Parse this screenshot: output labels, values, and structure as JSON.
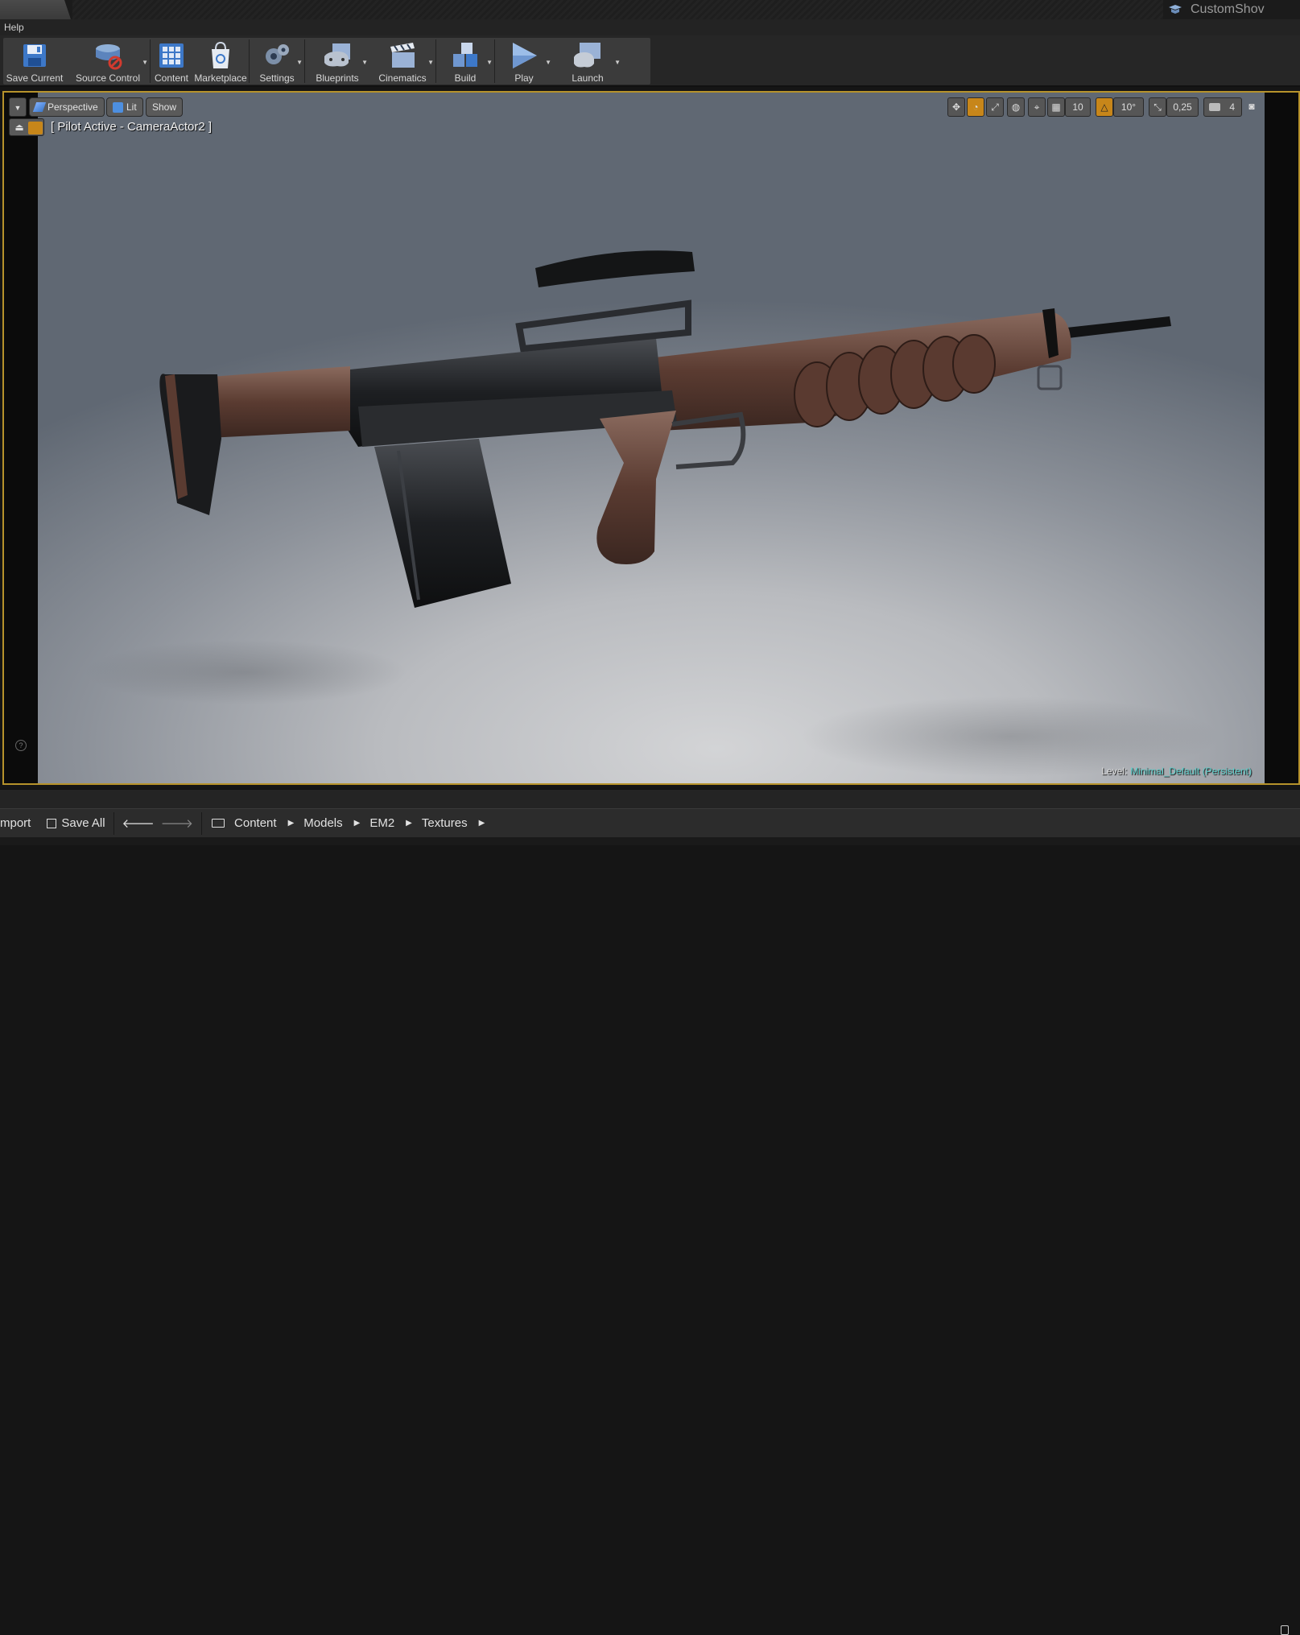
{
  "title_bar": {
    "project_name": "CustomShov"
  },
  "menu": {
    "items": [
      "Help"
    ]
  },
  "toolbar": {
    "buttons": [
      {
        "id": "save-current",
        "label": "Save Current"
      },
      {
        "id": "source-control",
        "label": "Source Control"
      },
      {
        "id": "content",
        "label": "Content"
      },
      {
        "id": "marketplace",
        "label": "Marketplace"
      },
      {
        "id": "settings",
        "label": "Settings"
      },
      {
        "id": "blueprints",
        "label": "Blueprints"
      },
      {
        "id": "cinematics",
        "label": "Cinematics"
      },
      {
        "id": "build",
        "label": "Build"
      },
      {
        "id": "play",
        "label": "Play"
      },
      {
        "id": "launch",
        "label": "Launch"
      }
    ]
  },
  "viewport": {
    "view_mode": "Perspective",
    "lighting": "Lit",
    "show": "Show",
    "grid_snap": "10",
    "rotation_snap": "10°",
    "scale_snap": "0,25",
    "camera_speed": "4",
    "pilot_label": "[ Pilot Active - CameraActor2 ]",
    "level_label": "Level:",
    "level_name": "Minimal_Default (Persistent)",
    "accent_color": "#b6922b"
  },
  "content_browser": {
    "import_label": "mport",
    "save_all_label": "Save All",
    "breadcrumb": [
      "Content",
      "Models",
      "EM2",
      "Textures"
    ]
  }
}
